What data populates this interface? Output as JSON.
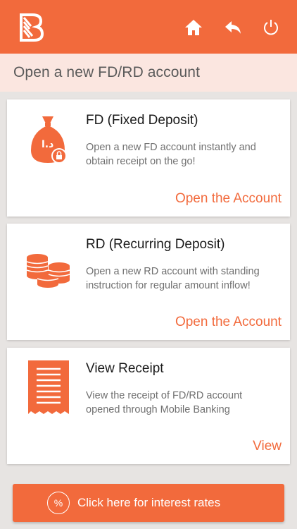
{
  "colors": {
    "accent": "#f26a3c",
    "title_bar": "#fbe6e0",
    "background": "#e7e4e2"
  },
  "appbar": {
    "logo_icon": "bank-of-baroda-logo",
    "actions": [
      {
        "icon": "home-icon"
      },
      {
        "icon": "back-arrow-icon"
      },
      {
        "icon": "power-icon"
      }
    ]
  },
  "page": {
    "title": "Open a new FD/RD account"
  },
  "cards": [
    {
      "icon": "money-bag-lock-icon",
      "title": "FD (Fixed Deposit)",
      "description": "Open a new FD account instantly and obtain receipt on the go!",
      "action": "Open the Account"
    },
    {
      "icon": "coin-stacks-icon",
      "title": "RD (Recurring Deposit)",
      "description": "Open a new RD account with standing instruction for regular amount inflow!",
      "action": "Open the Account"
    },
    {
      "icon": "receipt-icon",
      "title": "View Receipt",
      "description": "View the receipt of FD/RD account opened through Mobile Banking",
      "action": "View"
    }
  ],
  "footer": {
    "rates_icon_glyph": "%",
    "rates_label": "Click here for interest rates"
  }
}
